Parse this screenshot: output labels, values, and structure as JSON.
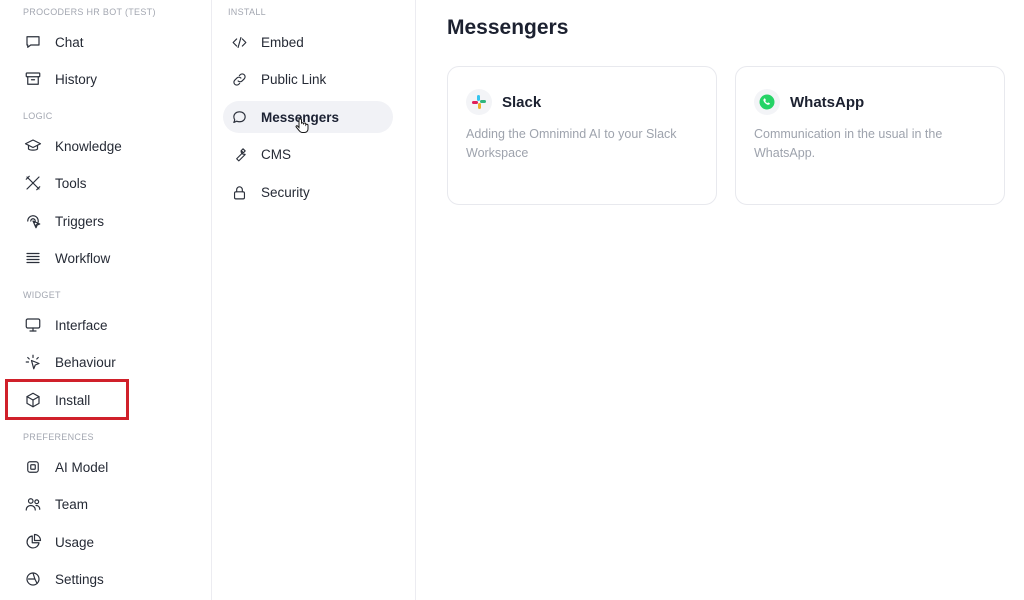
{
  "sidebar": {
    "sections": [
      {
        "title": "PROCODERS HR BOT (TEST)"
      },
      {
        "title": "LOGIC"
      },
      {
        "title": "WIDGET"
      },
      {
        "title": "PREFERENCES"
      }
    ],
    "items": [
      {
        "label": "Chat",
        "icon": "chat-icon"
      },
      {
        "label": "History",
        "icon": "archive-icon"
      },
      {
        "label": "Knowledge",
        "icon": "graduation-cap-icon"
      },
      {
        "label": "Tools",
        "icon": "tools-icon"
      },
      {
        "label": "Triggers",
        "icon": "trigger-icon"
      },
      {
        "label": "Workflow",
        "icon": "workflow-icon"
      },
      {
        "label": "Interface",
        "icon": "monitor-icon"
      },
      {
        "label": "Behaviour",
        "icon": "sparkle-cursor-icon"
      },
      {
        "label": "Install",
        "icon": "cube-icon"
      },
      {
        "label": "AI Model",
        "icon": "chip-icon"
      },
      {
        "label": "Team",
        "icon": "team-icon"
      },
      {
        "label": "Usage",
        "icon": "pie-chart-icon"
      },
      {
        "label": "Settings",
        "icon": "settings-icon"
      }
    ],
    "selected": "Install"
  },
  "subnav": {
    "title": "INSTALL",
    "items": [
      {
        "label": "Embed",
        "icon": "code-icon"
      },
      {
        "label": "Public Link",
        "icon": "link-icon"
      },
      {
        "label": "Messengers",
        "icon": "message-icon"
      },
      {
        "label": "CMS",
        "icon": "wrench-icon"
      },
      {
        "label": "Security",
        "icon": "lock-icon"
      }
    ],
    "active": "Messengers"
  },
  "main": {
    "title": "Messengers",
    "cards": [
      {
        "title": "Slack",
        "description": "Adding the Omnimind AI to your Slack Workspace",
        "icon": "slack-icon"
      },
      {
        "title": "WhatsApp",
        "description": "Communication in the usual in the WhatsApp.",
        "icon": "whatsapp-icon"
      }
    ]
  },
  "colors": {
    "highlight": "#d0202a",
    "active_bg": "#f1f2f6",
    "whatsapp": "#25d366"
  }
}
